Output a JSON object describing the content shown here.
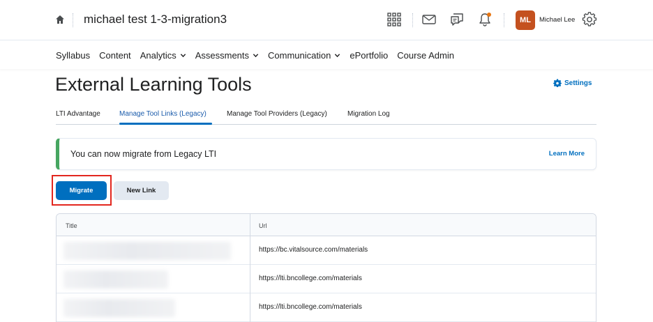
{
  "header": {
    "course_title": "michael test 1-3-migration3",
    "user_initials": "ML",
    "user_name": "Michael Lee",
    "avatar_color": "#c4511f",
    "icons": [
      "home-icon",
      "waffle-grid-icon",
      "mail-icon",
      "chat-icon",
      "bell-icon",
      "gear-icon"
    ]
  },
  "nav": {
    "items": [
      {
        "label": "Syllabus",
        "dropdown": false
      },
      {
        "label": "Content",
        "dropdown": false
      },
      {
        "label": "Analytics",
        "dropdown": true
      },
      {
        "label": "Assessments",
        "dropdown": true
      },
      {
        "label": "Communication",
        "dropdown": true
      },
      {
        "label": "ePortfolio",
        "dropdown": false
      },
      {
        "label": "Course Admin",
        "dropdown": false
      }
    ]
  },
  "page": {
    "title": "External Learning Tools",
    "settings_label": "Settings"
  },
  "tabs": [
    {
      "label": "LTI Advantage",
      "active": false
    },
    {
      "label": "Manage Tool Links (Legacy)",
      "active": true
    },
    {
      "label": "Manage Tool Providers (Legacy)",
      "active": false
    },
    {
      "label": "Migration Log",
      "active": false
    }
  ],
  "alert": {
    "message": "You can now migrate from Legacy LTI",
    "link": "Learn More",
    "accent": "#46a661"
  },
  "buttons": {
    "migrate": "Migrate",
    "new_link": "New Link"
  },
  "table": {
    "columns": [
      "Title",
      "Url"
    ],
    "rows": [
      {
        "title": "",
        "url": "https://bc.vitalsource.com/materials"
      },
      {
        "title": "",
        "url": "https://lti.bncollege.com/materials"
      },
      {
        "title": "",
        "url": "https://lti.bncollege.com/materials"
      }
    ]
  },
  "colors": {
    "primary": "#006fbf",
    "highlight": "#e2261e",
    "notification_dot": "#e87511"
  }
}
